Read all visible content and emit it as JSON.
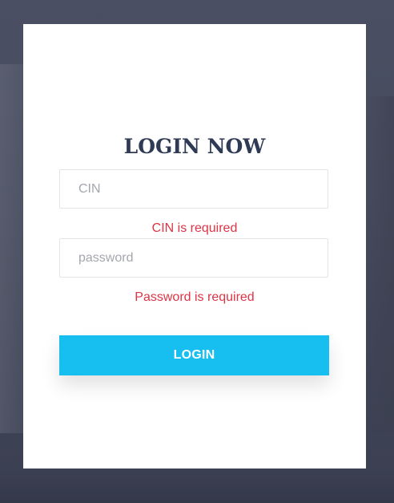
{
  "login_form": {
    "title": "LOGIN NOW",
    "cin_field": {
      "value": "",
      "placeholder": "CIN",
      "error": "CIN is required"
    },
    "password_field": {
      "value": "",
      "placeholder": "password",
      "error": "Password is required"
    },
    "submit_label": "LOGIN"
  },
  "colors": {
    "title": "#2f3a54",
    "error": "#dc3545",
    "button": "#17bff0",
    "card": "#ffffff",
    "background": "#464b5d"
  }
}
